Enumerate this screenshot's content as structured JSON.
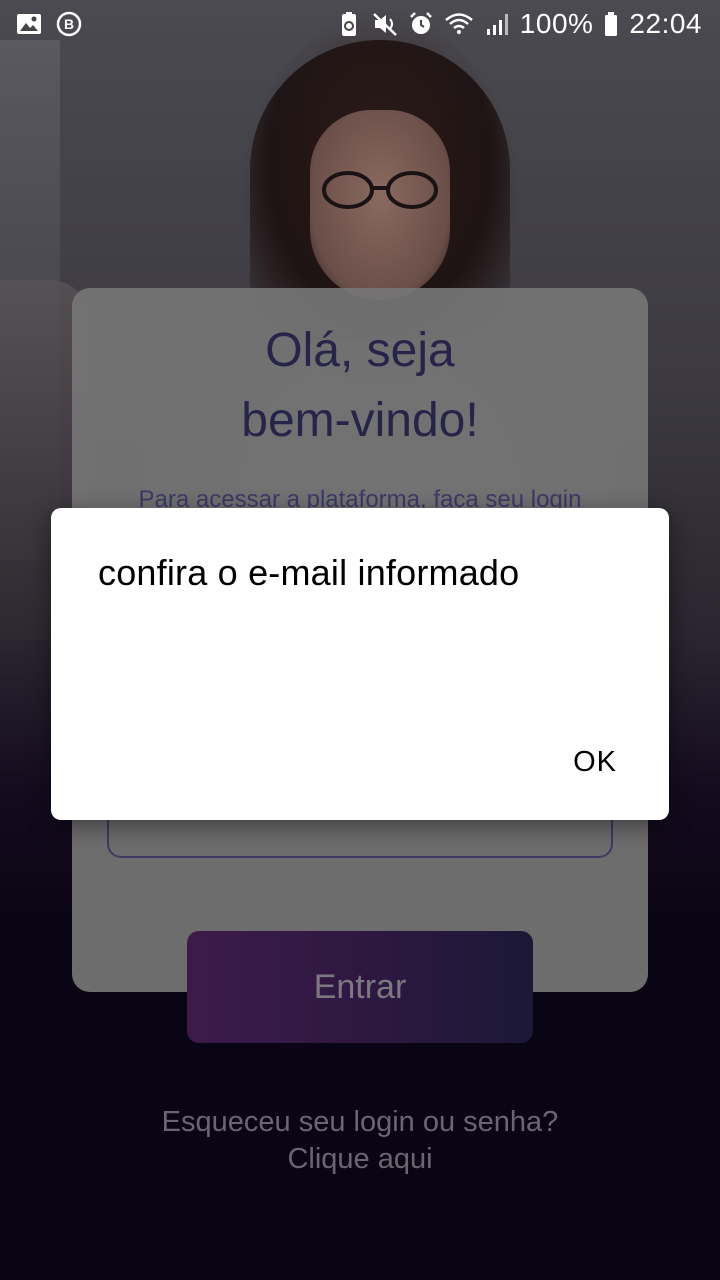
{
  "statusbar": {
    "battery": "100%",
    "time": "22:04",
    "icons": [
      "gallery-icon",
      "b-badge-icon",
      "battery-saver-icon",
      "mute-icon",
      "alarm-icon",
      "wifi-icon",
      "signal-icon",
      "battery-icon"
    ]
  },
  "login": {
    "title_line1": "Olá, seja",
    "title_line2": "bem-vindo!",
    "subtitle": "Para acessar a plataforma, faça seu login",
    "submit_label": "Entrar",
    "forgot_line1": "Esqueceu seu login ou senha?",
    "forgot_line2": "Clique aqui"
  },
  "dialog": {
    "message": "confira o e-mail informado",
    "ok_label": "OK"
  },
  "colors": {
    "title": "#27244a",
    "button_gradient_start": "#3d1a4a",
    "button_gradient_end": "#1c1836",
    "dialog_bg": "#ffffff"
  }
}
